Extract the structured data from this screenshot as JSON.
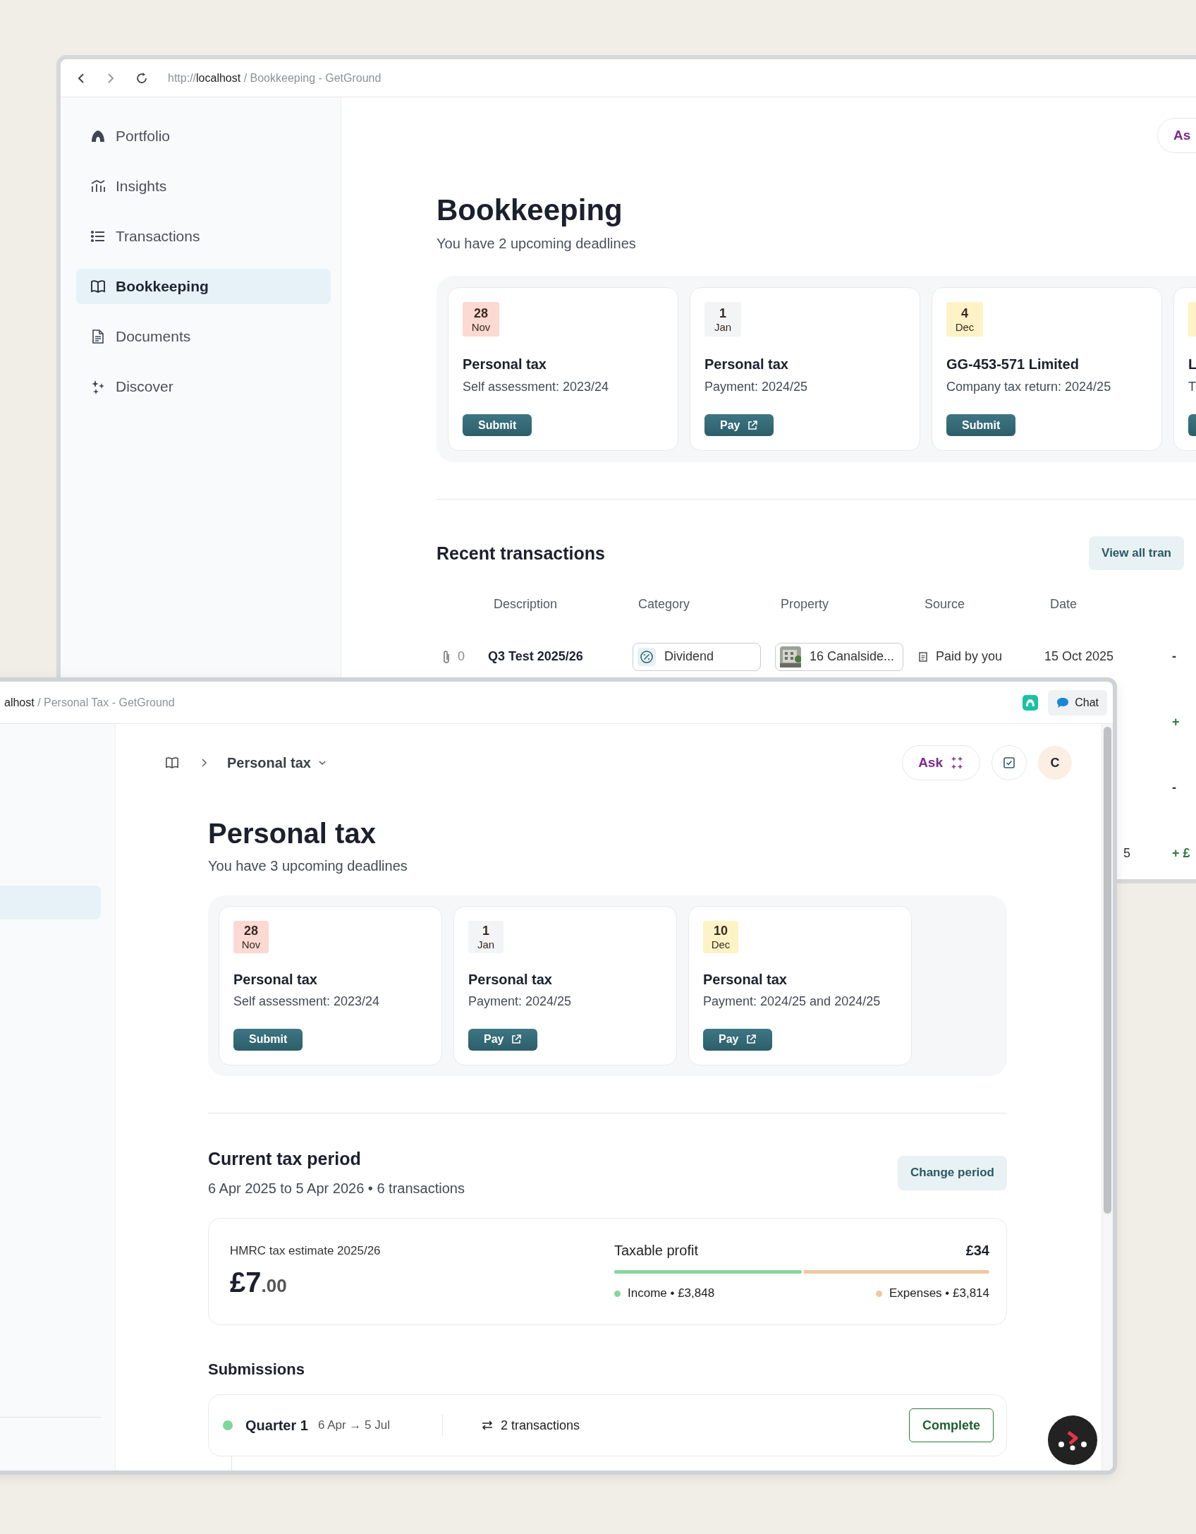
{
  "back_window": {
    "address": {
      "scheme": "http://",
      "host": "localhost",
      "rest": " / Bookkeeping - GetGround"
    },
    "sidebar": {
      "items": [
        {
          "label": "Portfolio",
          "selected": false
        },
        {
          "label": "Insights",
          "selected": false
        },
        {
          "label": "Transactions",
          "selected": false
        },
        {
          "label": "Bookkeeping",
          "selected": true
        },
        {
          "label": "Documents",
          "selected": false
        },
        {
          "label": "Discover",
          "selected": false
        }
      ]
    },
    "ask_button": "As",
    "title": "Bookkeeping",
    "subtitle": "You have 2 upcoming deadlines",
    "deadlines": [
      {
        "day": "28",
        "month": "Nov",
        "color": "#fcd9d3",
        "title": "Personal tax",
        "subtitle": "Self assessment: 2023/24",
        "action": "Submit",
        "external": false
      },
      {
        "day": "1",
        "month": "Jan",
        "color": "#f3f4f6",
        "title": "Personal tax",
        "subtitle": "Payment: 2024/25",
        "action": "Pay",
        "external": true
      },
      {
        "day": "4",
        "month": "Dec",
        "color": "#fdf3c7",
        "title": "GG-453-571 Limited",
        "subtitle": "Company tax return: 2024/25",
        "action": "Submit",
        "external": false
      },
      {
        "color": "#fdf3c7",
        "title": "L",
        "subtitle": "T"
      }
    ],
    "recent": {
      "title": "Recent transactions",
      "view_all": "View all tran",
      "columns": [
        "Description",
        "Category",
        "Property",
        "Source",
        "Date"
      ],
      "rows": [
        {
          "attachments": "0",
          "description": "Q3 Test 2025/26",
          "category": "Dividend",
          "property": "16 Canalside...",
          "source": "Paid by you",
          "date": "15 Oct 2025",
          "amount": "-",
          "color": "#333333"
        },
        {
          "amount": "+",
          "color": "#2d7a3e"
        },
        {
          "amount": "-",
          "color": "#333333"
        },
        {
          "date": "5",
          "amount": "+ £",
          "color": "#2d7a3e"
        }
      ]
    }
  },
  "front_window": {
    "address": {
      "host": "alhost",
      "rest": " / Personal Tax - GetGround"
    },
    "chat_button": "Chat",
    "sidebar": {
      "items": [
        {
          "selected": true
        }
      ]
    },
    "breadcrumb": "Personal tax",
    "ask_button": "Ask",
    "avatar": "C",
    "title": "Personal tax",
    "subtitle": "You have 3 upcoming deadlines",
    "deadlines": [
      {
        "day": "28",
        "month": "Nov",
        "color": "#fcd9d3",
        "title": "Personal tax",
        "subtitle": "Self assessment: 2023/24",
        "action": "Submit",
        "external": false
      },
      {
        "day": "1",
        "month": "Jan",
        "color": "#f3f4f6",
        "title": "Personal tax",
        "subtitle": "Payment: 2024/25",
        "action": "Pay",
        "external": true
      },
      {
        "day": "10",
        "month": "Dec",
        "color": "#fdf3c7",
        "title": "Personal tax",
        "subtitle": "Payment: 2024/25 and 2024/25",
        "action": "Pay",
        "external": true
      }
    ],
    "tax_period": {
      "title": "Current tax period",
      "subtitle": "6 Apr 2025 to 5 Apr 2026 • 6 transactions",
      "change_button": "Change period"
    },
    "estimate": {
      "label": "HMRC tax estimate 2025/26",
      "amount": "£7",
      "pence": ".00",
      "profit_label": "Taxable profit",
      "profit_value": "£34",
      "level": 0.5,
      "income": "Income • £3,848",
      "expenses": "Expenses • £3,814"
    },
    "submissions": {
      "title": "Submissions",
      "rows": [
        {
          "name": "Quarter 1",
          "dates": "6 Apr → 5 Jul",
          "transactions": "2 transactions",
          "status": "Complete",
          "color": "#7ed69a"
        }
      ]
    }
  }
}
